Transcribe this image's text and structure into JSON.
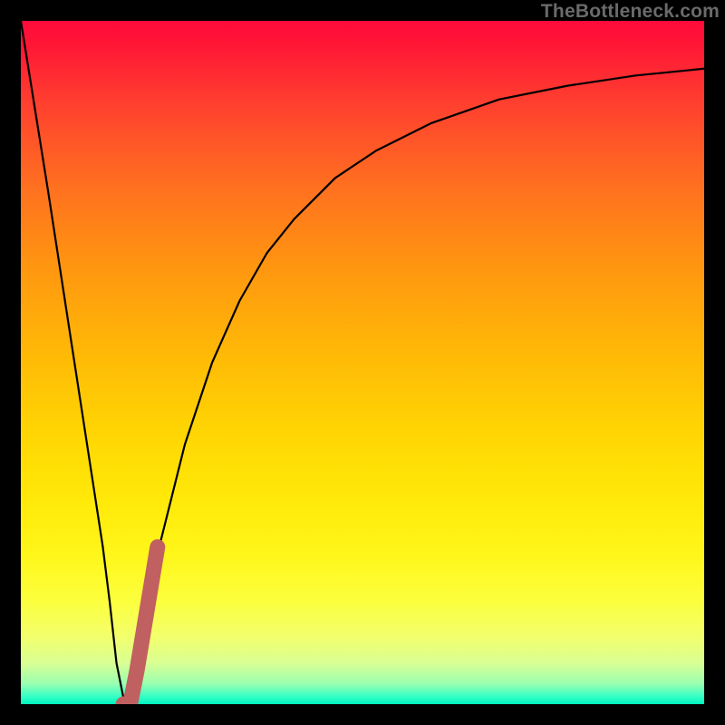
{
  "watermark": "TheBottleneck.com",
  "colors": {
    "background": "#000000",
    "curve": "#000000",
    "marker": "#c06060",
    "gradient_top": "#ff0b3a",
    "gradient_bottom": "#00f3bf"
  },
  "chart_data": {
    "type": "line",
    "title": "",
    "xlabel": "",
    "ylabel": "",
    "xlim": [
      0,
      100
    ],
    "ylim": [
      0,
      100
    ],
    "series": [
      {
        "name": "bottleneck-curve",
        "x": [
          0,
          4,
          8,
          10,
          12,
          13,
          14,
          15,
          16,
          18,
          20,
          24,
          28,
          32,
          36,
          40,
          46,
          52,
          60,
          70,
          80,
          90,
          100
        ],
        "values": [
          100,
          75,
          49,
          36,
          23,
          15,
          6,
          1,
          0,
          12,
          22,
          38,
          50,
          59,
          66,
          71,
          77,
          81,
          85,
          88.5,
          90.5,
          92,
          93
        ]
      },
      {
        "name": "marker-stroke",
        "x": [
          15,
          16,
          17,
          18,
          19,
          20
        ],
        "values": [
          0,
          0,
          5,
          11,
          17,
          23
        ]
      }
    ],
    "annotations": []
  }
}
